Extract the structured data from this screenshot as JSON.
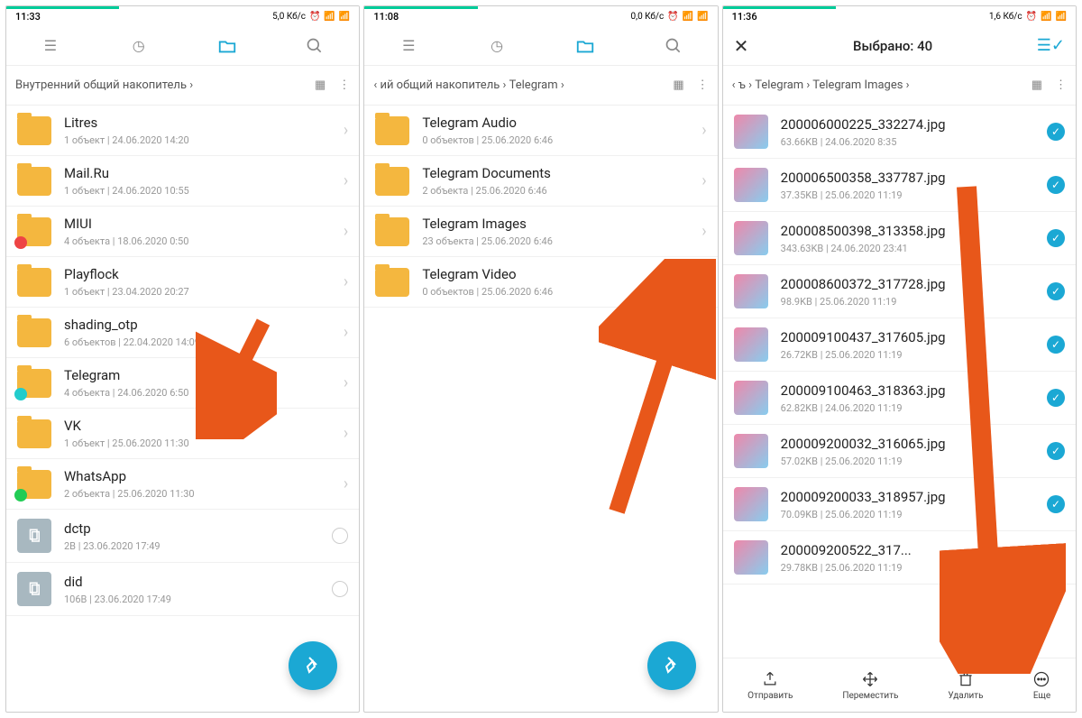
{
  "screens": [
    {
      "time": "11:33",
      "net": "5,0 Кб/с",
      "breadcrumb": "Внутренний общий накопитель ›",
      "items": [
        {
          "name": "Litres",
          "sub": "1 объект | 24.06.2020 14:20",
          "type": "folder"
        },
        {
          "name": "Mail.Ru",
          "sub": "1 объект | 24.06.2020 10:55",
          "type": "folder"
        },
        {
          "name": "MIUI",
          "sub": "4 объекта | 18.06.2020 0:50",
          "type": "folder",
          "badge": "red"
        },
        {
          "name": "Playflock",
          "sub": "1 объект | 23.04.2020 20:27",
          "type": "folder"
        },
        {
          "name": "shading_otp",
          "sub": "6 объектов | 22.04.2020 14:09",
          "type": "folder"
        },
        {
          "name": "Telegram",
          "sub": "4 объекта | 24.06.2020 6:50",
          "type": "folder",
          "badge": "teal"
        },
        {
          "name": "VK",
          "sub": "1 объект | 25.06.2020 11:30",
          "type": "folder"
        },
        {
          "name": "WhatsApp",
          "sub": "2 объекта | 25.06.2020 11:30",
          "type": "folder",
          "badge": "green"
        },
        {
          "name": "dctp",
          "sub": "2B | 23.06.2020 17:49",
          "type": "file"
        },
        {
          "name": "did",
          "sub": "106B | 23.06.2020 17:49",
          "type": "file"
        }
      ]
    },
    {
      "time": "11:08",
      "net": "0,0 Кб/с",
      "breadcrumb": "‹   ий общий накопитель › Telegram ›",
      "items": [
        {
          "name": "Telegram Audio",
          "sub": "0 объектов | 25.06.2020 6:46",
          "type": "folder"
        },
        {
          "name": "Telegram Documents",
          "sub": "2 объекта | 25.06.2020 6:46",
          "type": "folder"
        },
        {
          "name": "Telegram Images",
          "sub": "23 объекта | 25.06.2020 6:46",
          "type": "folder"
        },
        {
          "name": "Telegram Video",
          "sub": "0 объектов | 25.06.2020 6:46",
          "type": "folder"
        }
      ]
    },
    {
      "time": "11:36",
      "net": "1,6 Кб/с",
      "selected": "Выбрано: 40",
      "breadcrumb": "‹   ъ › Telegram › Telegram Images ›",
      "items": [
        {
          "name": "200006000225_332274.jpg",
          "sub": "63.66KB | 24.06.2020 8:35",
          "type": "image"
        },
        {
          "name": "200006500358_337787.jpg",
          "sub": "37.35KB | 25.06.2020 11:19",
          "type": "image"
        },
        {
          "name": "200008500398_313358.jpg",
          "sub": "343.63KB | 24.06.2020 23:41",
          "type": "image"
        },
        {
          "name": "200008600372_317728.jpg",
          "sub": "98.9KB | 25.06.2020 11:19",
          "type": "image"
        },
        {
          "name": "200009100437_317605.jpg",
          "sub": "26.72KB | 25.06.2020 11:19",
          "type": "image"
        },
        {
          "name": "200009100463_318363.jpg",
          "sub": "62.82KB | 24.06.2020 11:19",
          "type": "image"
        },
        {
          "name": "200009200032_316065.jpg",
          "sub": "57.02KB | 25.06.2020 11:19",
          "type": "image"
        },
        {
          "name": "200009200033_318957.jpg",
          "sub": "70.09KB | 25.06.2020 11:19",
          "type": "image"
        },
        {
          "name": "200009200522_317...",
          "sub": "29.78KB | 25.06.2020 11:19",
          "type": "image"
        }
      ],
      "actions": [
        "Отправить",
        "Переместить",
        "Удалить",
        "Еще"
      ]
    }
  ]
}
